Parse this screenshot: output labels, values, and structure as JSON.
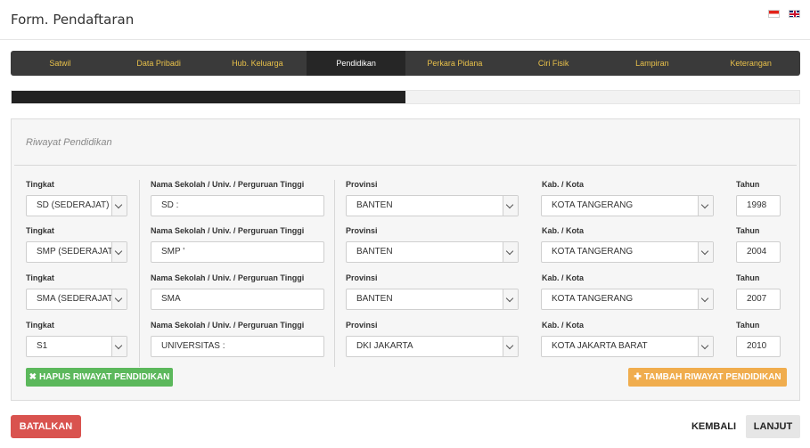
{
  "page": {
    "title": "Form. Pendaftaran",
    "flags": [
      "flag-id-icon",
      "flag-uk-icon"
    ]
  },
  "wizard": {
    "steps": [
      "Satwil",
      "Data Pribadi",
      "Hub. Keluarga",
      "Pendidikan",
      "Perkara Pidana",
      "Ciri Fisik",
      "Lampiran",
      "Keterangan"
    ],
    "active_index": 3
  },
  "progress": {
    "fraction": 0.5
  },
  "section": {
    "title": "Riwayat Pendidikan",
    "labels": {
      "tingkat": "Tingkat",
      "sekolah": "Nama Sekolah / Univ. / Perguruan Tinggi",
      "provinsi": "Provinsi",
      "kab": "Kab. / Kota",
      "tahun": "Tahun"
    },
    "rows": [
      {
        "tingkat": "SD (SEDERAJAT)",
        "sekolah": "SD :",
        "provinsi": "BANTEN",
        "kab": "KOTA TANGERANG",
        "tahun": "1998"
      },
      {
        "tingkat": "SMP (SEDERAJAT",
        "sekolah": "SMP '",
        "provinsi": "BANTEN",
        "kab": "KOTA TANGERANG",
        "tahun": "2004"
      },
      {
        "tingkat": "SMA (SEDERAJAT",
        "sekolah": "SMA",
        "provinsi": "BANTEN",
        "kab": "KOTA TANGERANG",
        "tahun": "2007"
      },
      {
        "tingkat": "S1",
        "sekolah": "UNIVERSITAS :",
        "provinsi": "DKI JAKARTA",
        "kab": "KOTA JAKARTA BARAT",
        "tahun": "2010"
      }
    ],
    "remove_button": {
      "icon": "✖",
      "label": "HAPUS RIWAYAT PENDIDIKAN"
    },
    "add_button": {
      "icon": "✚",
      "label": "TAMBAH RIWAYAT PENDIDIKAN"
    }
  },
  "footer": {
    "cancel_label": "BATALKAN",
    "back_label": "KEMBALI",
    "next_label": "LANJUT"
  },
  "colors": {
    "wizard_bg": "#3a3a3a",
    "wizard_text": "#e8c04a",
    "danger": "#d9534f",
    "success": "#5cb85c",
    "warning": "#f0ad4e"
  }
}
